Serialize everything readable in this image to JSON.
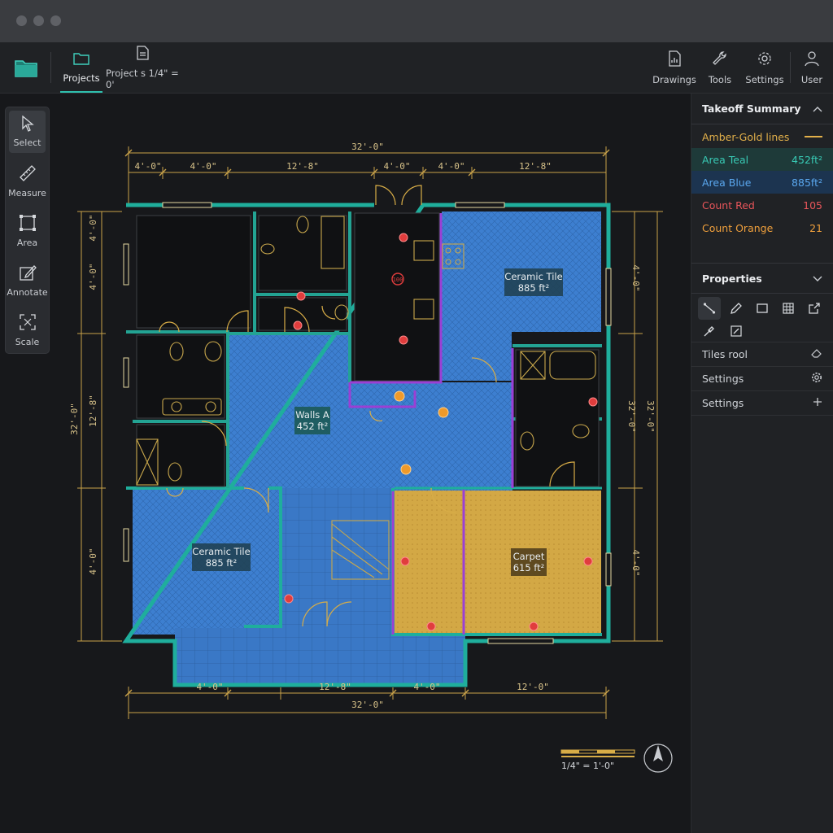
{
  "window": {
    "controls": [
      "close",
      "minimize",
      "maximize"
    ]
  },
  "toolbar": {
    "left": [
      {
        "name": "folder-app-icon"
      },
      {
        "label": "Projects",
        "icon": "folder-icon",
        "active": true
      },
      {
        "label": "Project s  1/4\" = 0'",
        "icon": "document-icon",
        "active": false
      }
    ],
    "right": [
      {
        "label": "Drawings",
        "icon": "drawings-icon"
      },
      {
        "label": "Tools",
        "icon": "wrench-icon"
      },
      {
        "label": "Settings",
        "icon": "gear-icon"
      },
      {
        "label": "User",
        "icon": "user-icon"
      }
    ]
  },
  "tools": [
    {
      "label": "Select",
      "icon": "cursor-icon",
      "active": true
    },
    {
      "label": "Measure",
      "icon": "ruler-icon",
      "active": false
    },
    {
      "label": "Area",
      "icon": "area-icon",
      "active": false
    },
    {
      "label": "Annotate",
      "icon": "annotate-icon",
      "active": false
    },
    {
      "label": "Scale",
      "icon": "scale-icon",
      "active": false
    }
  ],
  "takeoff": {
    "title": "Takeoff Summary",
    "rows": [
      {
        "label": "Amber-Gold lines",
        "value": "",
        "color": "#e2b04a"
      },
      {
        "label": "Area Teal",
        "value": "452ft²",
        "color": "#38c9b4"
      },
      {
        "label": "Area Blue",
        "value": "885ft²",
        "color": "#5aa7ee"
      },
      {
        "label": "Count Red",
        "value": "105",
        "color": "#e8555a"
      },
      {
        "label": "Count Orange",
        "value": "21",
        "color": "#f0a03c"
      }
    ]
  },
  "properties": {
    "title": "Properties",
    "icons": [
      "line-tool-icon",
      "pencil-icon",
      "rectangle-icon",
      "grid-icon",
      "export-icon",
      "eyedropper-icon",
      "edit-box-icon"
    ],
    "rows": [
      {
        "label": "Tiles rool",
        "icon": "eraser-icon"
      },
      {
        "label": "Settings",
        "icon": "gear-icon"
      },
      {
        "label": "Settings",
        "icon": "plus-icon"
      }
    ]
  },
  "plan": {
    "dims_top": [
      "32'-0\"",
      "4'-0\"",
      "4'-0\"",
      "12'-8\"",
      "4'-0\"",
      "4'-0\"",
      "12'-8\""
    ],
    "dims_bottom": [
      "4'-0\"",
      "12'-8\"",
      "4'-0\"",
      "12'-0\"",
      "32'-0\""
    ],
    "dims_left": [
      "4'-0\"",
      "4'-0\"",
      "12'-8\"",
      "32'-0\"",
      "4'-0\""
    ],
    "dims_right": [
      "4'-0\"",
      "32'-0\"",
      "32'-0\"",
      "4'-0\""
    ],
    "labels": [
      {
        "name": "Ceramic Tile",
        "area": "885 ft²"
      },
      {
        "name": "Walls A",
        "area": "452 ft²"
      },
      {
        "name": "Ceramic Tile",
        "area": "885 ft²"
      },
      {
        "name": "Carpet",
        "area": "615 ft²"
      }
    ],
    "marker_text": "100",
    "scale_label": "1/4\" = 1'-0\""
  },
  "colors": {
    "teal": "#1fae9c",
    "blue": "#3d7fd0",
    "gold": "#d8ad47",
    "purple": "#9b3fd4",
    "red": "#e03d3d",
    "orange": "#ef9a2b"
  }
}
